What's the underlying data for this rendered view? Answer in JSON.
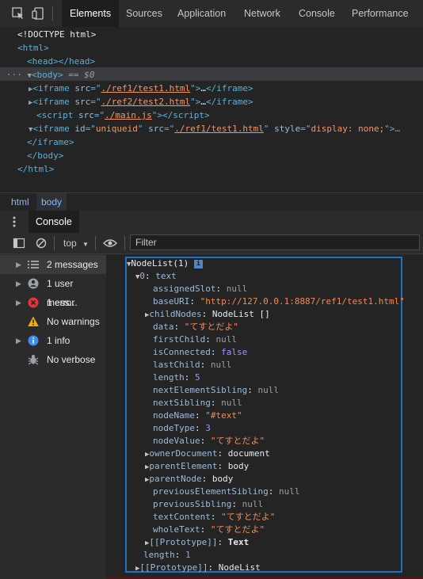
{
  "toolbar": {
    "tabs": [
      "Elements",
      "Sources",
      "Application",
      "Network",
      "Console",
      "Performance"
    ],
    "active_tab": "Elements"
  },
  "tree": {
    "doctype": "<!DOCTYPE html>",
    "html_open": "<html>",
    "head": "<head></head>",
    "body_open": "<body>",
    "body_marker": "== $0",
    "iframe1_src": "./ref1/test1.html",
    "iframe2_src": "./ref2/test2.html",
    "script_src": "./main.js",
    "iframe3_id": "uniqueid",
    "iframe3_src": "./ref1/test1.html",
    "iframe3_style": "display: none;",
    "iframe_close": "</iframe>",
    "body_close": "</body>",
    "html_close": "</html>"
  },
  "breadcrumbs": [
    "html",
    "body"
  ],
  "drawer": {
    "tab": "Console",
    "context": "top",
    "filter_placeholder": "Filter"
  },
  "sidebar": {
    "items": [
      {
        "label": "2 messages",
        "icon": "list-icon"
      },
      {
        "label": "1 user mess...",
        "icon": "user-icon"
      },
      {
        "label": "1 error",
        "icon": "error-icon"
      },
      {
        "label": "No warnings",
        "icon": "warning-icon"
      },
      {
        "label": "1 info",
        "icon": "info-icon"
      },
      {
        "label": "No verbose",
        "icon": "bug-icon"
      }
    ]
  },
  "output": {
    "header": "NodeList(1)",
    "item_index": "0",
    "item_type": "text",
    "props": [
      {
        "key": "assignedSlot",
        "value": "null",
        "kind": "null"
      },
      {
        "key": "baseURI",
        "value": "\"http://127.0.0.1:8887/ref1/test1.html\"",
        "kind": "string"
      },
      {
        "key": "childNodes",
        "value": "NodeList []",
        "kind": "obj",
        "expand": true
      },
      {
        "key": "data",
        "value": "\"てすとだよ\"",
        "kind": "string"
      },
      {
        "key": "firstChild",
        "value": "null",
        "kind": "null"
      },
      {
        "key": "isConnected",
        "value": "false",
        "kind": "bool"
      },
      {
        "key": "lastChild",
        "value": "null",
        "kind": "null"
      },
      {
        "key": "length",
        "value": "5",
        "kind": "num"
      },
      {
        "key": "nextElementSibling",
        "value": "null",
        "kind": "null"
      },
      {
        "key": "nextSibling",
        "value": "null",
        "kind": "null"
      },
      {
        "key": "nodeName",
        "value": "\"#text\"",
        "kind": "string"
      },
      {
        "key": "nodeType",
        "value": "3",
        "kind": "num"
      },
      {
        "key": "nodeValue",
        "value": "\"てすとだよ\"",
        "kind": "string"
      },
      {
        "key": "ownerDocument",
        "value": "document",
        "kind": "obj",
        "expand": true
      },
      {
        "key": "parentElement",
        "value": "body",
        "kind": "obj",
        "expand": true
      },
      {
        "key": "parentNode",
        "value": "body",
        "kind": "obj",
        "expand": true
      },
      {
        "key": "previousElementSibling",
        "value": "null",
        "kind": "null"
      },
      {
        "key": "previousSibling",
        "value": "null",
        "kind": "null"
      },
      {
        "key": "textContent",
        "value": "\"てすとだよ\"",
        "kind": "string"
      },
      {
        "key": "wholeText",
        "value": "\"てすとだよ\"",
        "kind": "string"
      },
      {
        "key": "[[Prototype]]",
        "value": "Text",
        "kind": "proto",
        "expand": true
      }
    ],
    "list_length_key": "length",
    "list_length_value": "1",
    "list_proto_key": "[[Prototype]]",
    "list_proto_value": "NodeList"
  },
  "colors": {
    "accent": "#1a73c8",
    "error": "#e8333a",
    "warning": "#f9ab00",
    "info": "#3c8bf4"
  }
}
